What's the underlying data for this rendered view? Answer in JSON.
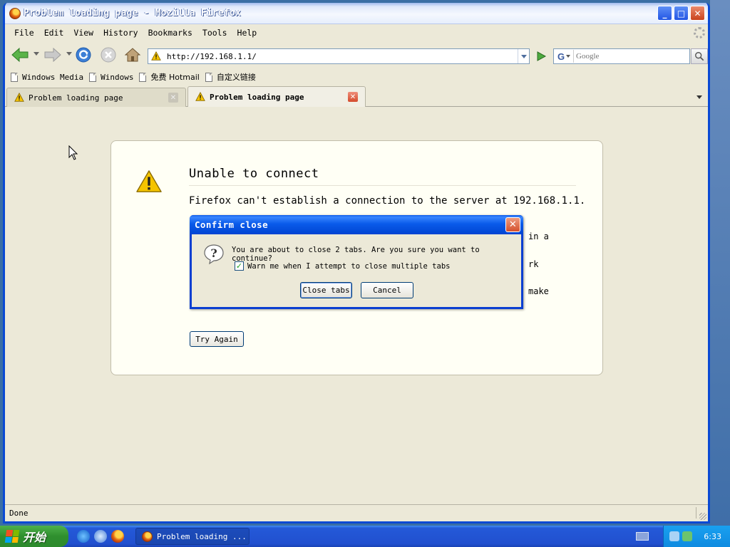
{
  "window": {
    "title": "Problem loading page - Mozilla Firefox",
    "minimize_label": "_",
    "maximize_label": "□",
    "close_label": "✕"
  },
  "menubar": {
    "items": [
      "File",
      "Edit",
      "View",
      "History",
      "Bookmarks",
      "Tools",
      "Help"
    ]
  },
  "navbar": {
    "url": "http://192.168.1.1/",
    "search_placeholder": "Google",
    "search_engine_letter": "G"
  },
  "bookmarks": {
    "items": [
      "Windows Media",
      "Windows",
      "免费 Hotmail",
      "自定义链接"
    ]
  },
  "tabs": [
    {
      "label": "Problem loading page",
      "active": false
    },
    {
      "label": "Problem loading page",
      "active": true
    }
  ],
  "error_page": {
    "title": "Unable to connect",
    "line1": "Firefox can't establish a connection to the server at 192.168.1.1.",
    "fragments": [
      "in a",
      "rk",
      "make"
    ],
    "try_again_label": "Try Again"
  },
  "dialog": {
    "title": "Confirm close",
    "message": "You are about to close 2 tabs. Are you sure you want to continue?",
    "checkbox_label": "Warn me when I attempt to close multiple tabs",
    "checkbox_checked": true,
    "ok_label": "Close tabs",
    "cancel_label": "Cancel"
  },
  "statusbar": {
    "text": "Done"
  },
  "taskbar": {
    "start_label": "开始",
    "task_label": "Problem loading ...",
    "clock": "6:33"
  },
  "colors": {
    "xp_blue": "#0a49d4",
    "xp_green": "#2f8f2e",
    "window_bg": "#ece9d8",
    "error_box_bg": "#fffff5",
    "warning_yellow": "#f5c400"
  }
}
